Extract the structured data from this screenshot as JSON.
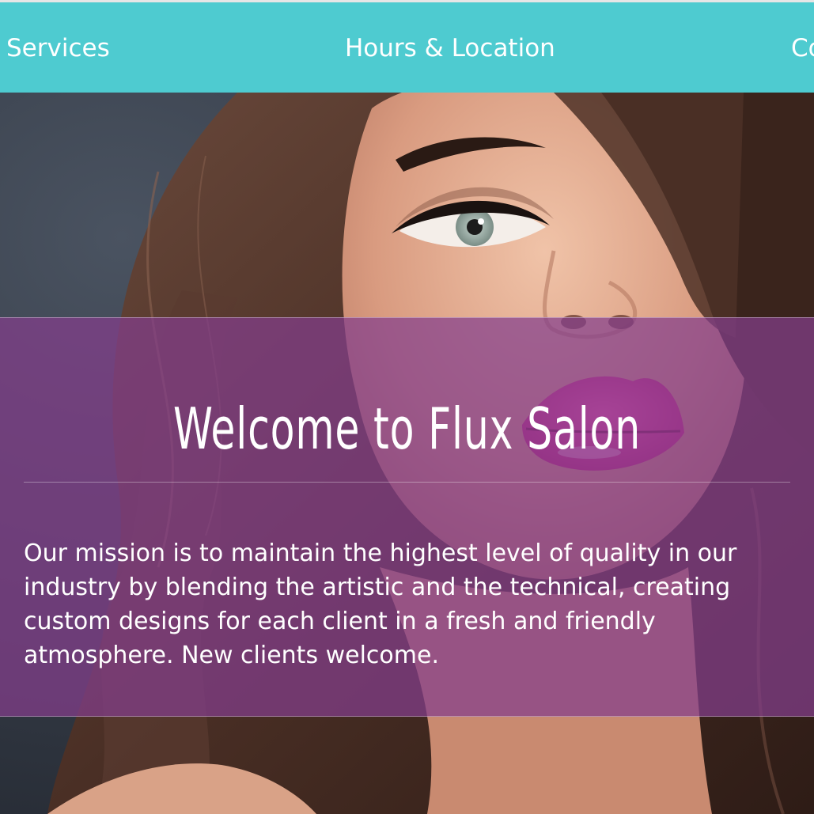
{
  "nav": {
    "items": [
      {
        "label": "Services"
      },
      {
        "label": "Hours & Location"
      },
      {
        "label": "Co"
      }
    ],
    "background_color": "#4ecbd0"
  },
  "hero": {
    "image_alt": "Salon model portrait",
    "overlay_color": "#843e8c"
  },
  "welcome": {
    "title": "Welcome to Flux Salon",
    "mission": "Our mission is to maintain the highest level of quality in our industry by blending the artistic and the technical, creating custom designs for each client in a fresh and friendly atmosphere. New clients welcome."
  }
}
